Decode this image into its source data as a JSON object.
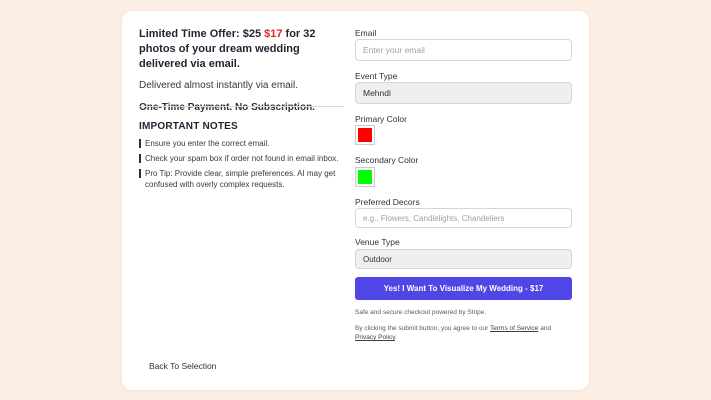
{
  "offer": {
    "prefix": "Limited Time Offer: ",
    "old_price": "$25",
    "new_price": "$17",
    "suffix": " for 32 photos of your dream wedding delivered via email.",
    "delivered": "Delivered almost instantly via email.",
    "one_time": "One-Time Payment. No Subscription.",
    "new_price_color": "#e02424"
  },
  "notes": {
    "title": "IMPORTANT NOTES",
    "items": [
      "Ensure you enter the correct email.",
      "Check your spam box if order not found in email inbox.",
      "Pro Tip: Provide clear, simple preferences. AI may get confused with overly complex requests."
    ]
  },
  "back_label": "Back To Selection",
  "form": {
    "email_label": "Email",
    "email_placeholder": "Enter your email",
    "event_type_label": "Event Type",
    "event_type_value": "Mehndi",
    "primary_color_label": "Primary Color",
    "primary_color_value": "#ff0000",
    "secondary_color_label": "Secondary Color",
    "secondary_color_value": "#00ff00",
    "decors_label": "Preferred Decors",
    "decors_placeholder": "e.g., Flowers, Candlelights, Chandeliers",
    "venue_type_label": "Venue Type",
    "venue_type_value": "Outdoor",
    "submit_label": "Yes! I Want To Visualize My Wedding - $17",
    "secure_text": "Safe and secure checkout powered by Stripe.",
    "agree_prefix": "By clicking the submit button, you agree to our ",
    "terms_link": "Terms of Service",
    "agree_and": " and ",
    "privacy_link": "Privacy Policy",
    "agree_suffix": "."
  },
  "colors": {
    "background": "#fdeee4",
    "accent": "#4f46e5"
  }
}
